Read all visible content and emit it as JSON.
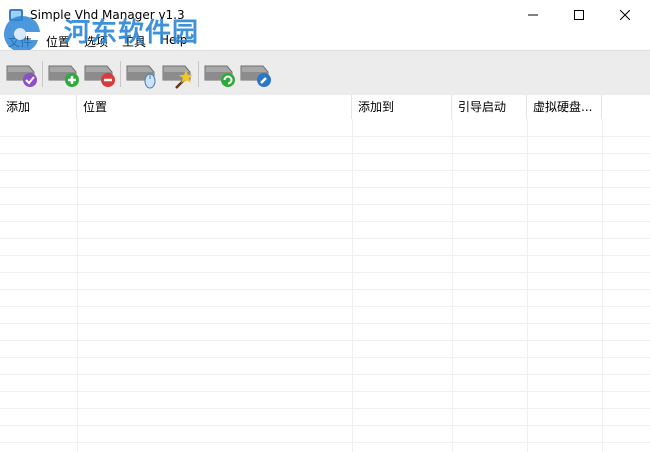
{
  "window": {
    "title": "Simple Vhd Manager v1.3",
    "controls": [
      "minimize",
      "maximize",
      "close"
    ]
  },
  "menu": [
    "文件",
    "位置",
    "选项",
    "工具",
    "Help"
  ],
  "watermark": {
    "text": "河东软件园",
    "url": "www.pc0359.cn"
  },
  "toolbar": {
    "buttons": [
      {
        "icon": "disk-check-icon"
      },
      {
        "icon": "disk-add-icon"
      },
      {
        "icon": "disk-remove-icon"
      },
      {
        "icon": "disk-mouse-icon"
      },
      {
        "icon": "disk-wand-icon"
      },
      {
        "icon": "disk-refresh-icon"
      },
      {
        "icon": "disk-wrench-icon"
      }
    ]
  },
  "list": {
    "columns": [
      "添加",
      "位置",
      "添加到",
      "引导启动",
      "虚拟硬盘..."
    ],
    "rows": []
  },
  "colors": {
    "toolbar_bg": "#ececec",
    "add_green": "#2eaa3a",
    "remove_red": "#d93a3a",
    "watermark_blue": "#2b86d6"
  }
}
